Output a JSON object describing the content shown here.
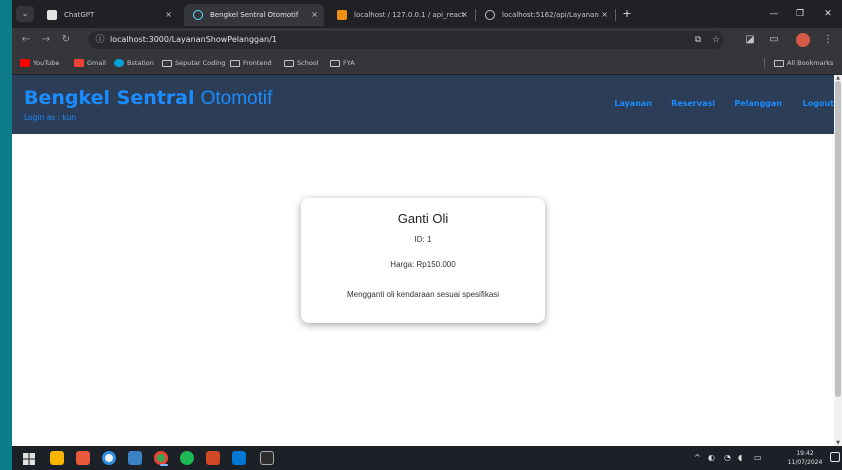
{
  "browser": {
    "tabs": [
      {
        "title": "ChatGPT",
        "active": false,
        "close": "×"
      },
      {
        "title": "Bengkel Sentral Otomotif",
        "active": true,
        "close": "×"
      },
      {
        "title": "localhost / 127.0.0.1 / api_react",
        "active": false,
        "close": "×"
      },
      {
        "title": "localhost:5162/api/Layanan",
        "active": false,
        "close": "×"
      }
    ],
    "new_tab": "+",
    "url": "localhost:3000/LayananShowPelanggan/1",
    "bookmarks": [
      "YouTube",
      "Gmail",
      "Bstation",
      "Seputar Coding",
      "Frontend",
      "School",
      "FYA"
    ],
    "all_bookmarks": "All Bookmarks"
  },
  "header": {
    "brand_bold": "Bengkel Sentral",
    "brand_light": "Otomotif",
    "login_text": "Login as : kun",
    "nav": [
      "Layanan",
      "Reservasi",
      "Pelanggan",
      "Logout"
    ]
  },
  "card": {
    "title": "Ganti Oli",
    "id_text": "ID: 1",
    "price_text": "Harga: Rp150.000",
    "description": "Mengganti oli kendaraan sesuai spesifikasi"
  },
  "taskbar": {
    "time": "19:42",
    "date": "11/07/2024"
  },
  "colors": {
    "header_bg": "#2c3e57",
    "brand": "#1a8cff"
  }
}
